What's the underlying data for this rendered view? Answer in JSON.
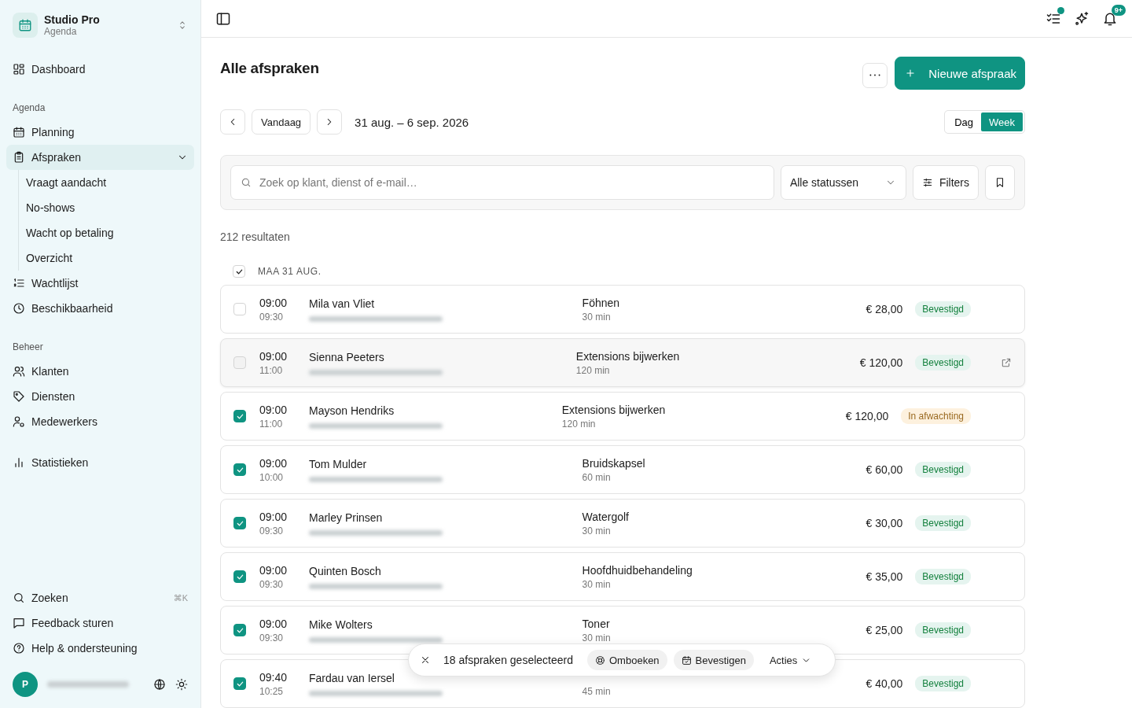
{
  "workspace": {
    "name": "Studio Pro",
    "subtitle": "Agenda"
  },
  "sidebar": {
    "sections": [
      {
        "items": [
          {
            "label": "Dashboard",
            "selected": false
          }
        ]
      },
      {
        "title": "Agenda",
        "items": [
          {
            "label": "Planning",
            "selected": false
          },
          {
            "label": "Afspraken",
            "selected": true,
            "expanded": true,
            "children": [
              {
                "label": "Vraagt aandacht"
              },
              {
                "label": "No-shows"
              },
              {
                "label": "Wacht op betaling"
              },
              {
                "label": "Overzicht"
              }
            ]
          },
          {
            "label": "Wachtlijst",
            "selected": false
          },
          {
            "label": "Beschikbaarheid",
            "selected": false
          }
        ]
      },
      {
        "title": "Beheer",
        "items": [
          {
            "label": "Klanten",
            "selected": false
          },
          {
            "label": "Diensten",
            "selected": false
          },
          {
            "label": "Medewerkers",
            "selected": false
          }
        ]
      },
      {
        "items": [
          {
            "label": "Statistieken",
            "selected": false
          }
        ]
      }
    ],
    "footer": [
      {
        "label": "Zoeken",
        "shortcut": "⌘K"
      },
      {
        "label": "Feedback sturen"
      },
      {
        "label": "Help & ondersteuning"
      }
    ],
    "user": {
      "initial": "P"
    }
  },
  "topbar": {
    "notification_count": "9+",
    "tasks_dot": true
  },
  "page": {
    "title": "Alle afspraken",
    "new_button": "Nieuwe afspraak",
    "date_nav": {
      "today": "Vandaag",
      "range": "31 aug. – 6 sep. 2026"
    },
    "view_toggle": [
      {
        "label": "Dag",
        "selected": false
      },
      {
        "label": "Week",
        "selected": true
      }
    ],
    "search": {
      "placeholder": "Zoek op klant, dienst of e-mail…"
    },
    "status_filter": "Alle statussen",
    "filters_button": "Filters",
    "result_count": "212 resultaten",
    "group": {
      "label": "MAA 31 AUG.",
      "checked": true
    },
    "appointments": [
      {
        "start": "09:00",
        "end": "09:30",
        "client": "Mila van Vliet",
        "service": "Föhnen",
        "duration": "30 min",
        "price": "€ 28,00",
        "status": "Bevestigd",
        "kind": "confirmed",
        "checked": false,
        "hovered": false
      },
      {
        "start": "09:00",
        "end": "11:00",
        "client": "Sienna Peeters",
        "service": "Extensions bijwerken",
        "duration": "120 min",
        "price": "€ 120,00",
        "status": "Bevestigd",
        "kind": "confirmed",
        "checked": false,
        "hovered": true
      },
      {
        "start": "09:00",
        "end": "11:00",
        "client": "Mayson Hendriks",
        "service": "Extensions bijwerken",
        "duration": "120 min",
        "price": "€ 120,00",
        "status": "In afwachting",
        "kind": "pending",
        "checked": true,
        "hovered": false
      },
      {
        "start": "09:00",
        "end": "10:00",
        "client": "Tom Mulder",
        "service": "Bruidskapsel",
        "duration": "60 min",
        "price": "€ 60,00",
        "status": "Bevestigd",
        "kind": "confirmed",
        "checked": true,
        "hovered": false
      },
      {
        "start": "09:00",
        "end": "09:30",
        "client": "Marley Prinsen",
        "service": "Watergolf",
        "duration": "30 min",
        "price": "€ 30,00",
        "status": "Bevestigd",
        "kind": "confirmed",
        "checked": true,
        "hovered": false
      },
      {
        "start": "09:00",
        "end": "09:30",
        "client": "Quinten Bosch",
        "service": "Hoofdhuidbehandeling",
        "duration": "30 min",
        "price": "€ 35,00",
        "status": "Bevestigd",
        "kind": "confirmed",
        "checked": true,
        "hovered": false
      },
      {
        "start": "09:00",
        "end": "09:30",
        "client": "Mike Wolters",
        "service": "Toner",
        "duration": "30 min",
        "price": "€ 25,00",
        "status": "Bevestigd",
        "kind": "confirmed",
        "checked": true,
        "hovered": false
      },
      {
        "start": "09:40",
        "end": "10:25",
        "client": "Fardau van Iersel",
        "duration": "45 min",
        "price": "€ 40,00",
        "status": "Bevestigd",
        "kind": "confirmed",
        "checked": true,
        "hovered": false
      }
    ],
    "bulk_bar": {
      "count_label": "18 afspraken geselecteerd",
      "actions": [
        {
          "label": "Omboeken"
        },
        {
          "label": "Bevestigen"
        }
      ],
      "menu": "Acties"
    }
  }
}
